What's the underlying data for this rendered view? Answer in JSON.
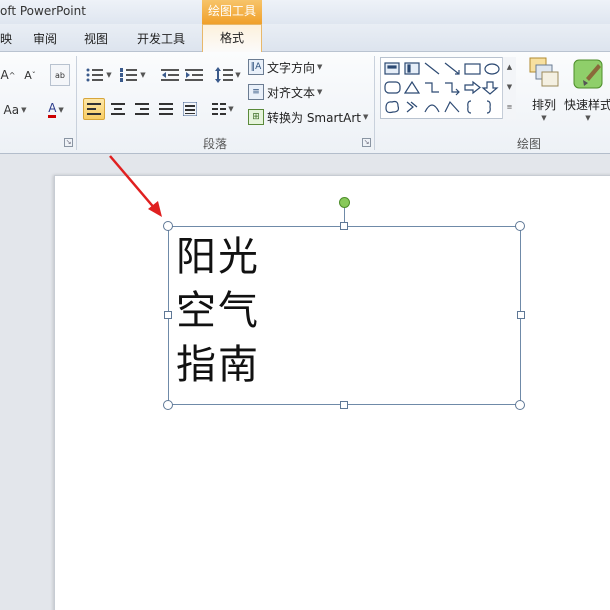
{
  "titlebar": {
    "app_title": "oft PowerPoint",
    "context_tab_header": "绘图工具"
  },
  "tabs": [
    {
      "label": "映"
    },
    {
      "label": "审阅"
    },
    {
      "label": "视图"
    },
    {
      "label": "开发工具"
    },
    {
      "label": "格式",
      "active": true
    }
  ],
  "font_group": {
    "grow_label": "A",
    "shrink_label": "A",
    "change_case_label": "Aa",
    "font_color_label": "A",
    "font_color": "#cc0000"
  },
  "paragraph_group": {
    "label": "段落",
    "text_direction": "文字方向",
    "align_text": "对齐文本",
    "convert_smartart": "转换为 SmartArt"
  },
  "drawing_group": {
    "label": "绘图",
    "arrange": "排列",
    "quick_styles": "快速样式"
  },
  "textbox": {
    "lines": [
      "阳光",
      "空气",
      "指南"
    ]
  },
  "annotation": {
    "arrow_color": "#e02020"
  },
  "accent_colors": {
    "context_tab": "#f0a02a",
    "rotation_handle": "#88c95b"
  }
}
